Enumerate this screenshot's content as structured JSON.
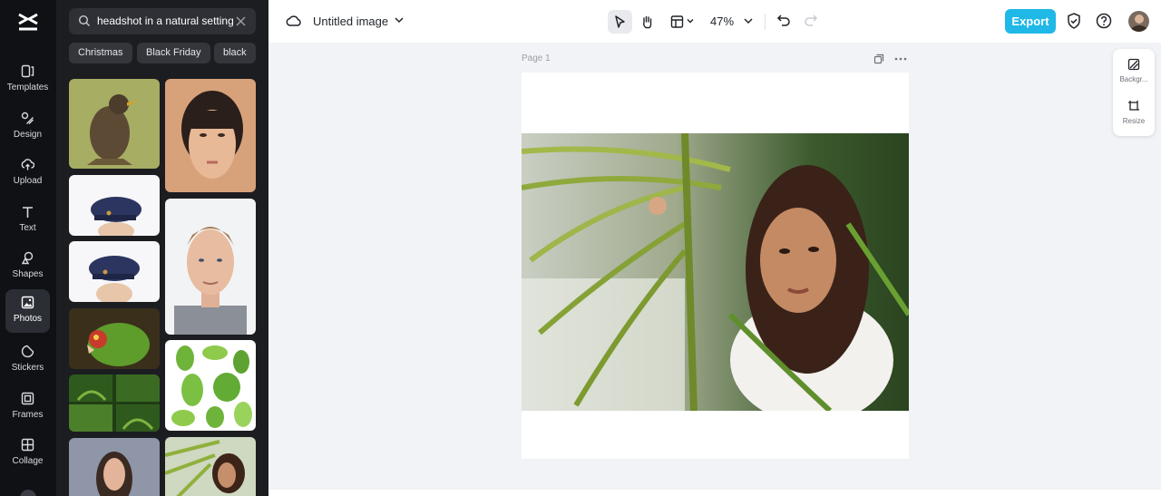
{
  "rail": {
    "items": [
      {
        "label": "Templates",
        "icon": "templates-icon"
      },
      {
        "label": "Design",
        "icon": "design-icon"
      },
      {
        "label": "Upload",
        "icon": "upload-icon"
      },
      {
        "label": "Text",
        "icon": "text-icon"
      },
      {
        "label": "Shapes",
        "icon": "shapes-icon"
      },
      {
        "label": "Photos",
        "icon": "photos-icon",
        "active": true
      },
      {
        "label": "Stickers",
        "icon": "stickers-icon"
      },
      {
        "label": "Frames",
        "icon": "frames-icon"
      },
      {
        "label": "Collage",
        "icon": "collage-icon"
      }
    ]
  },
  "panel": {
    "search_value": "headshot in a natural setting",
    "chips": [
      "Christmas",
      "Black Friday",
      "black"
    ]
  },
  "topbar": {
    "doc_title": "Untitled image",
    "zoom": "47%",
    "export_label": "Export"
  },
  "canvas": {
    "page_label": "Page 1"
  },
  "right_panel": {
    "items": [
      {
        "label": "Backgr...",
        "icon": "background-icon"
      },
      {
        "label": "Resize",
        "icon": "resize-icon"
      }
    ]
  },
  "colors": {
    "accent": "#1fb8e7",
    "rail_bg": "#101114",
    "panel_bg": "#1c1d21",
    "workspace_bg": "#f1f3f6"
  }
}
